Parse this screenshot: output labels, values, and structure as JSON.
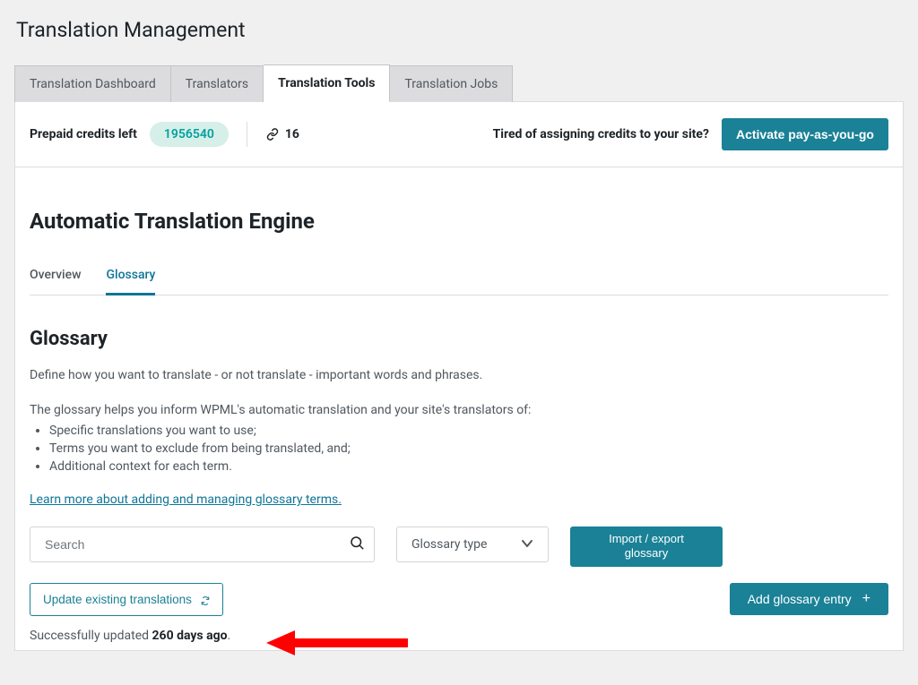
{
  "page": {
    "title": "Translation Management"
  },
  "tabs": [
    "Translation Dashboard",
    "Translators",
    "Translation Tools",
    "Translation Jobs"
  ],
  "credits": {
    "label": "Prepaid credits left",
    "value": "1956540",
    "link_count": "16",
    "cta_text": "Tired of assigning credits to your site?",
    "cta_button": "Activate pay-as-you-go"
  },
  "engine": {
    "title": "Automatic Translation Engine"
  },
  "subtabs": {
    "overview": "Overview",
    "glossary": "Glossary"
  },
  "glossary": {
    "heading": "Glossary",
    "intro": "Define how you want to translate - or not translate - important words and phrases.",
    "helper": "The glossary helps you inform WPML's automatic translation and your site's translators of:",
    "bullets": [
      "Specific translations you want to use;",
      "Terms you want to exclude from being translated, and;",
      "Additional context for each term."
    ],
    "learn_more": "Learn more about adding and managing glossary terms."
  },
  "toolbar": {
    "search_placeholder": "Search",
    "type_label": "Glossary type",
    "import_export": "Import / export glossary"
  },
  "actions": {
    "update_existing": "Update existing translations",
    "add_entry": "Add glossary entry"
  },
  "status": {
    "prefix": "Successfully updated ",
    "value": "260 days ago",
    "suffix": "."
  }
}
